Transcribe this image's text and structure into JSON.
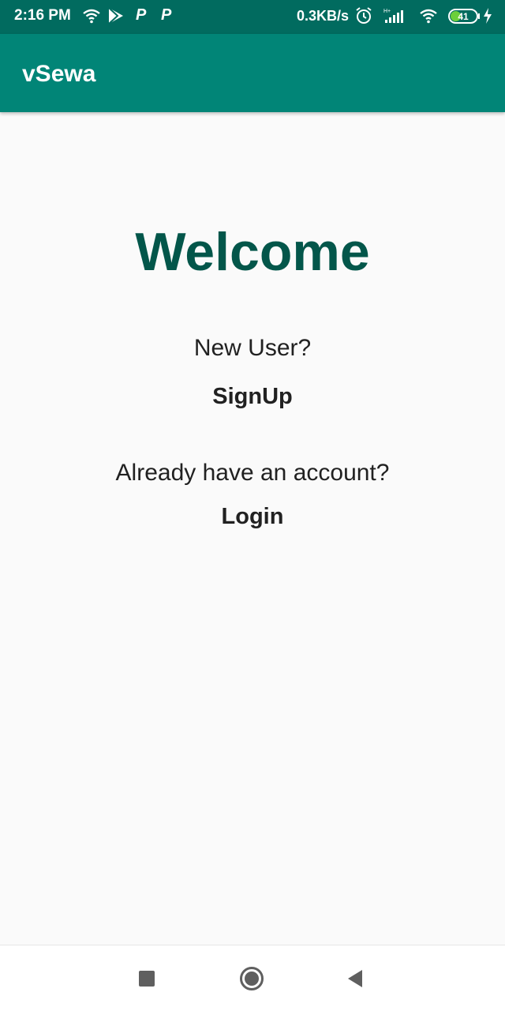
{
  "status_bar": {
    "time": "2:16 PM",
    "net_speed": "0.3KB/s",
    "p1": "P",
    "p2": "P",
    "battery_level": "41",
    "battery_fraction": 0.41,
    "icons": [
      "wifi-icon",
      "play-store-icon",
      "paytm-icon",
      "paytm-icon",
      "alarm-icon",
      "signal-icon",
      "wifi-icon",
      "battery-icon",
      "charging-icon"
    ]
  },
  "app_bar": {
    "title": "vSewa"
  },
  "main": {
    "welcome": "Welcome",
    "new_user_prompt": "New User?",
    "signup_label": "SignUp",
    "existing_prompt": "Already have an account?",
    "login_label": "Login"
  },
  "nav_bar": {
    "icons": [
      "recents-square-icon",
      "home-circle-icon",
      "back-triangle-icon"
    ]
  },
  "colors": {
    "status_bar": "#016b5f",
    "app_bar": "#018577",
    "welcome_text": "#03564a",
    "background": "#fafafa",
    "battery_fill": "#6ccf3a"
  }
}
